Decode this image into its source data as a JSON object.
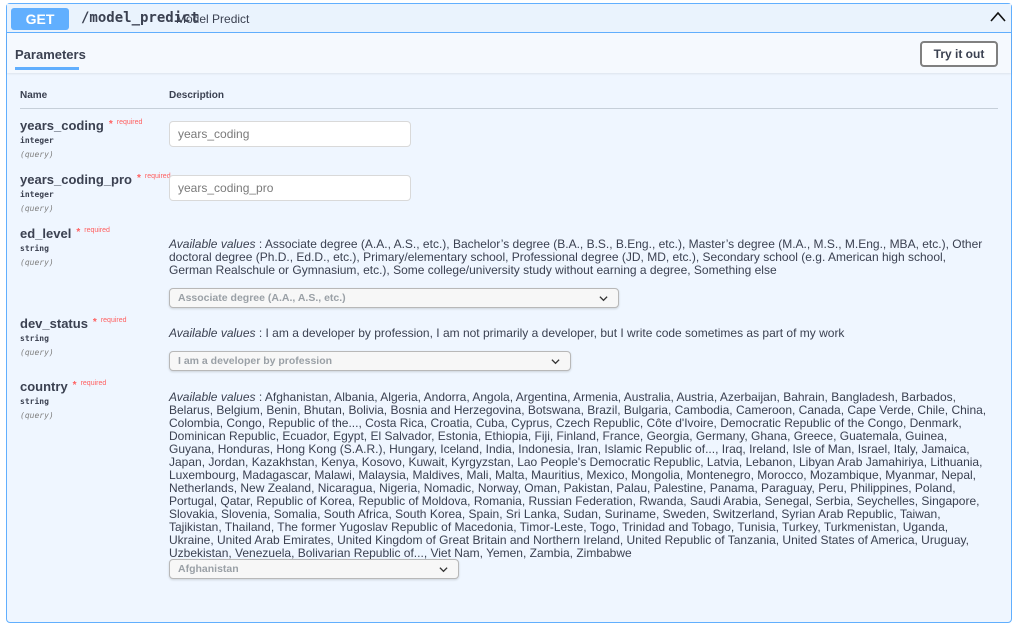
{
  "operation": {
    "method": "GET",
    "path": "/model_predict",
    "summary": "Model Predict"
  },
  "tabs": {
    "parameters": "Parameters"
  },
  "try_it_out": "Try it out",
  "columns": {
    "name": "Name",
    "description": "Description"
  },
  "required_label": "required",
  "params": [
    {
      "name": "years_coding",
      "type": "integer",
      "in": "(query)",
      "placeholder": "years_coding"
    },
    {
      "name": "years_coding_pro",
      "type": "integer",
      "in": "(query)",
      "placeholder": "years_coding_pro"
    },
    {
      "name": "ed_level",
      "type": "string",
      "in": "(query)",
      "available_label": "Available values",
      "available": " : Associate degree (A.A., A.S., etc.), Bachelor’s degree (B.A., B.S., B.Eng., etc.), Master’s degree (M.A., M.S., M.Eng., MBA, etc.), Other doctoral degree (Ph.D., Ed.D., etc.), Primary/elementary school, Professional degree (JD, MD, etc.), Secondary school (e.g. American high school, German Realschule or Gymnasium, etc.), Some college/university study without earning a degree, Something else",
      "selected": "Associate degree (A.A., A.S., etc.)"
    },
    {
      "name": "dev_status",
      "type": "string",
      "in": "(query)",
      "available_label": "Available values",
      "available": " : I am a developer by profession, I am not primarily a developer, but I write code sometimes as part of my work",
      "selected": "I am a developer by profession"
    },
    {
      "name": "country",
      "type": "string",
      "in": "(query)",
      "available_label": "Available values",
      "available": " : Afghanistan, Albania, Algeria, Andorra, Angola, Argentina, Armenia, Australia, Austria, Azerbaijan, Bahrain, Bangladesh, Barbados, Belarus, Belgium, Benin, Bhutan, Bolivia, Bosnia and Herzegovina, Botswana, Brazil, Bulgaria, Cambodia, Cameroon, Canada, Cape Verde, Chile, China, Colombia, Congo, Republic of the..., Costa Rica, Croatia, Cuba, Cyprus, Czech Republic, Côte d'Ivoire, Democratic Republic of the Congo, Denmark, Dominican Republic, Ecuador, Egypt, El Salvador, Estonia, Ethiopia, Fiji, Finland, France, Georgia, Germany, Ghana, Greece, Guatemala, Guinea, Guyana, Honduras, Hong Kong (S.A.R.), Hungary, Iceland, India, Indonesia, Iran, Islamic Republic of..., Iraq, Ireland, Isle of Man, Israel, Italy, Jamaica, Japan, Jordan, Kazakhstan, Kenya, Kosovo, Kuwait, Kyrgyzstan, Lao People's Democratic Republic, Latvia, Lebanon, Libyan Arab Jamahiriya, Lithuania, Luxembourg, Madagascar, Malawi, Malaysia, Maldives, Mali, Malta, Mauritius, Mexico, Mongolia, Montenegro, Morocco, Mozambique, Myanmar, Nepal, Netherlands, New Zealand, Nicaragua, Nigeria, Nomadic, Norway, Oman, Pakistan, Palau, Palestine, Panama, Paraguay, Peru, Philippines, Poland, Portugal, Qatar, Republic of Korea, Republic of Moldova, Romania, Russian Federation, Rwanda, Saudi Arabia, Senegal, Serbia, Seychelles, Singapore, Slovakia, Slovenia, Somalia, South Africa, South Korea, Spain, Sri Lanka, Sudan, Suriname, Sweden, Switzerland, Syrian Arab Republic, Taiwan, Tajikistan, Thailand, The former Yugoslav Republic of Macedonia, Timor-Leste, Togo, Trinidad and Tobago, Tunisia, Turkey, Turkmenistan, Uganda, Ukraine, United Arab Emirates, United Kingdom of Great Britain and Northern Ireland, United Republic of Tanzania, United States of America, Uruguay, Uzbekistan, Venezuela, Bolivarian Republic of..., Viet Nam, Yemen, Zambia, Zimbabwe",
      "selected": "Afghanistan"
    }
  ],
  "colors": {
    "get_accent": "#61affe",
    "required": "#ff6060"
  }
}
